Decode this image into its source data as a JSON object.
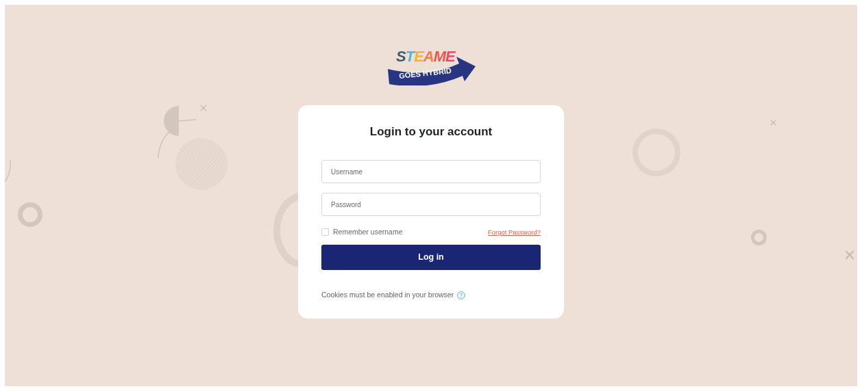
{
  "logo": {
    "title": "STEAME",
    "subtitle": "GOES HYBRID"
  },
  "login": {
    "title": "Login to your account",
    "fields": [
      {
        "placeholder": "Username"
      },
      {
        "placeholder": "Password"
      }
    ],
    "remember": {
      "label": "Remember username",
      "checked": false
    },
    "forgot_link": "Forgot Password?",
    "submit": "Log in",
    "cookies_note": "Cookies must be enabled in your browser"
  }
}
